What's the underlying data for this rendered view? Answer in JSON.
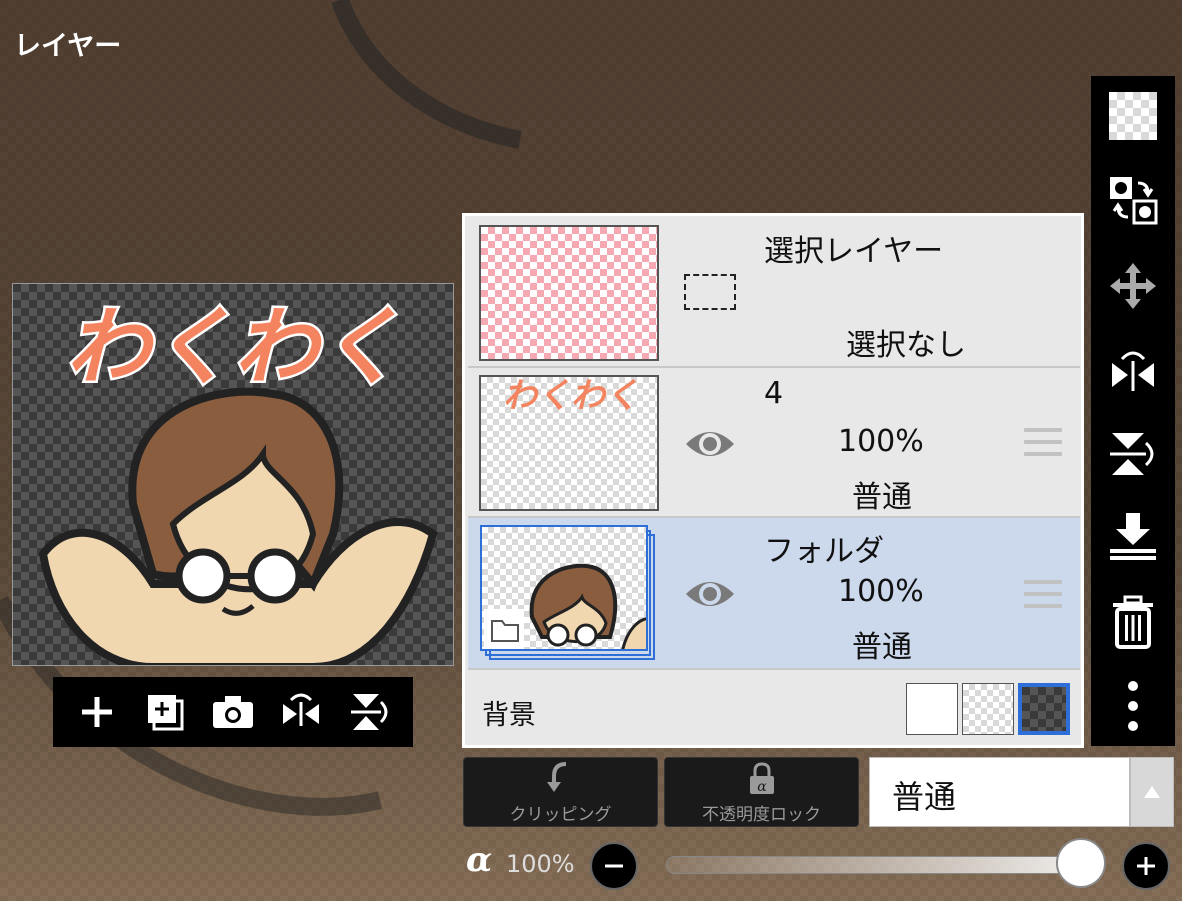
{
  "panel": {
    "title": "レイヤー"
  },
  "preview": {
    "caption": "わくわく"
  },
  "layers": [
    {
      "name": "選択レイヤー",
      "status": "選択なし",
      "kind": "selection",
      "selected": false
    },
    {
      "name": "4",
      "opacity": "100%",
      "blend": "普通",
      "kind": "raster",
      "visible": true,
      "selected": false
    },
    {
      "name": "フォルダ",
      "opacity": "100%",
      "blend": "普通",
      "kind": "folder",
      "visible": true,
      "selected": true
    }
  ],
  "background": {
    "label": "背景",
    "options": [
      "white",
      "transparent",
      "dark-checker"
    ],
    "active": "dark-checker"
  },
  "buttons": {
    "clipping": "クリッピング",
    "alpha_lock": "不透明度ロック"
  },
  "blend_mode": {
    "value": "普通"
  },
  "opacity": {
    "symbol": "α",
    "value": "100%",
    "level": 1.0
  },
  "icons": {
    "layer_toolbar": [
      "add-layer-icon",
      "add-special-layer-icon",
      "camera-icon",
      "flip-horizontal-icon",
      "flip-vertical-icon"
    ],
    "right_toolbar": [
      "transparent-checker-icon",
      "swap-layer-icon",
      "move-icon",
      "flip-horizontal-icon",
      "flip-vertical-icon",
      "merge-down-icon",
      "trash-icon",
      "more-icon"
    ]
  },
  "colors": {
    "selected_row": "#ccd8ec",
    "active_swatch": "#2d6fd6",
    "accent_text": "#f08060"
  }
}
